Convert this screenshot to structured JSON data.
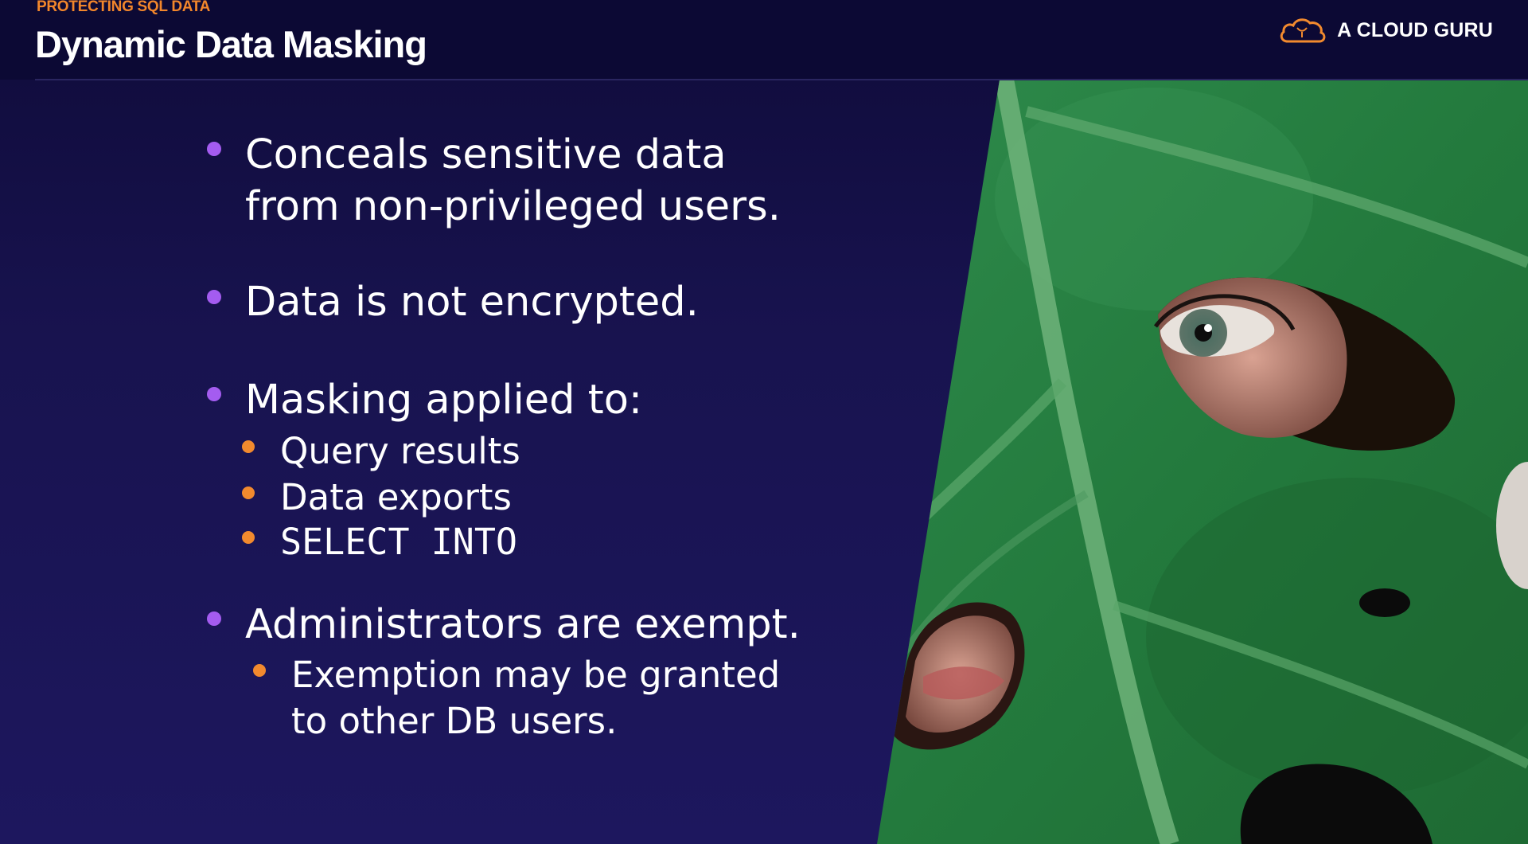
{
  "header": {
    "eyebrow": "PROTECTING SQL DATA",
    "title": "Dynamic Data Masking",
    "brand_name": "A CLOUD GURU",
    "brand_icon": "cloud-logo-icon"
  },
  "bullets": [
    {
      "lines": [
        "Conceals sensitive data",
        "from non-privileged users."
      ]
    },
    {
      "lines": [
        "Data is not encrypted."
      ]
    },
    {
      "lines": [
        "Masking applied to:"
      ],
      "subs": [
        "Query results",
        "Data exports",
        "SELECT  INTO"
      ]
    },
    {
      "lines": [
        "Administrators are exempt."
      ],
      "subs": [
        "Exemption may be granted",
        "to other DB users."
      ]
    }
  ],
  "colors": {
    "background": "#18134f",
    "accent_orange": "#f28a2e",
    "accent_purple": "#a45cf0",
    "leaf_green": "#2f8a45"
  }
}
